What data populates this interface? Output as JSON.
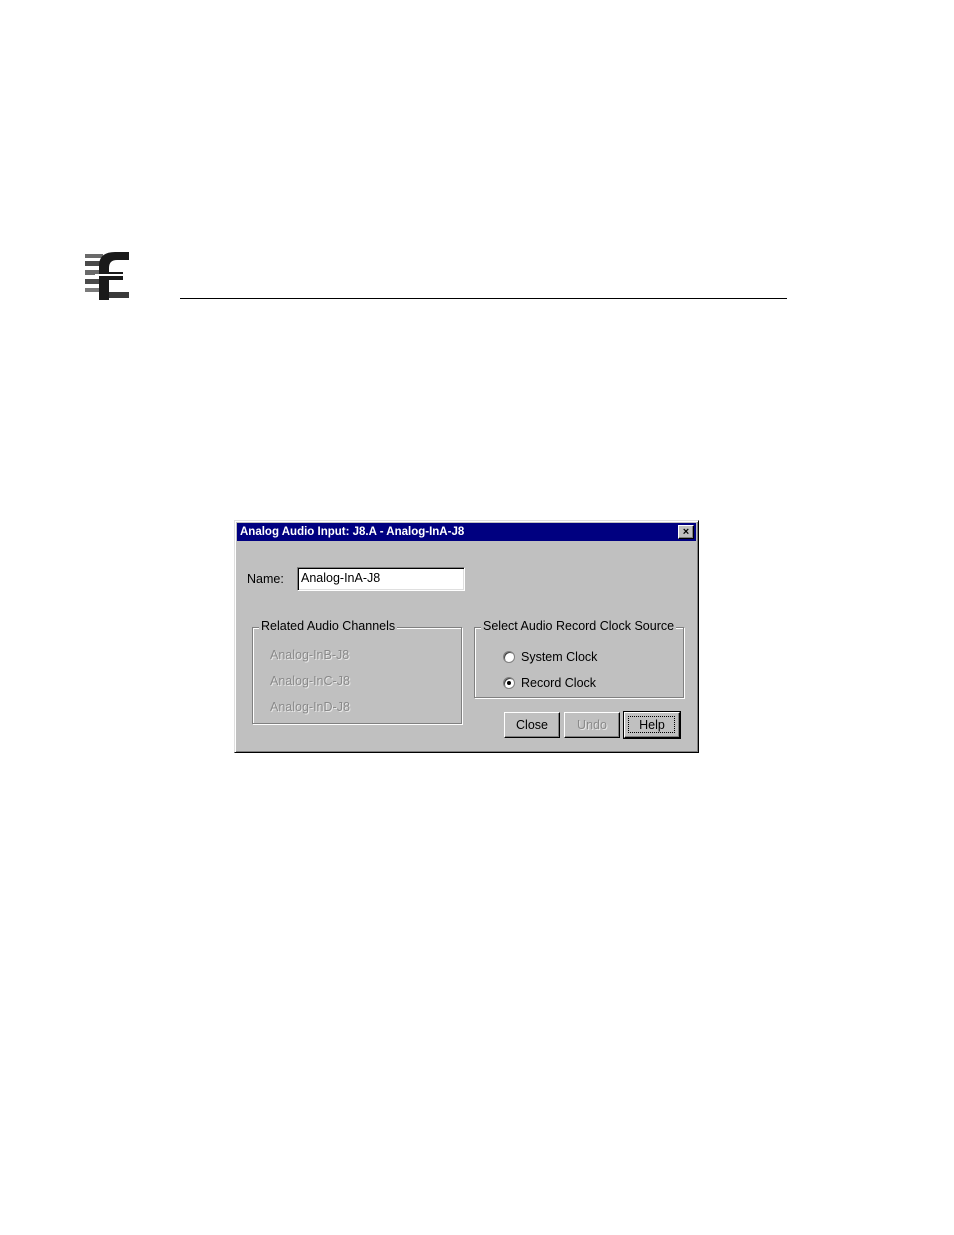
{
  "dialog": {
    "title": "Analog Audio Input: J8.A - Analog-InA-J8",
    "close_glyph": "×",
    "name_label": "Name:",
    "name_value": "Analog-InA-J8",
    "related_channels": {
      "legend": "Related Audio Channels",
      "items": [
        "Analog-InB-J8",
        "Analog-InC-J8",
        "Analog-InD-J8"
      ]
    },
    "clock_source": {
      "legend": "Select Audio Record Clock Source",
      "options": [
        {
          "label": "System Clock",
          "selected": false
        },
        {
          "label": "Record Clock",
          "selected": true
        }
      ]
    },
    "buttons": {
      "close": "Close",
      "undo": "Undo",
      "help": "Help"
    }
  },
  "colors": {
    "titlebar": "#000080",
    "face": "#c0c0c0"
  }
}
